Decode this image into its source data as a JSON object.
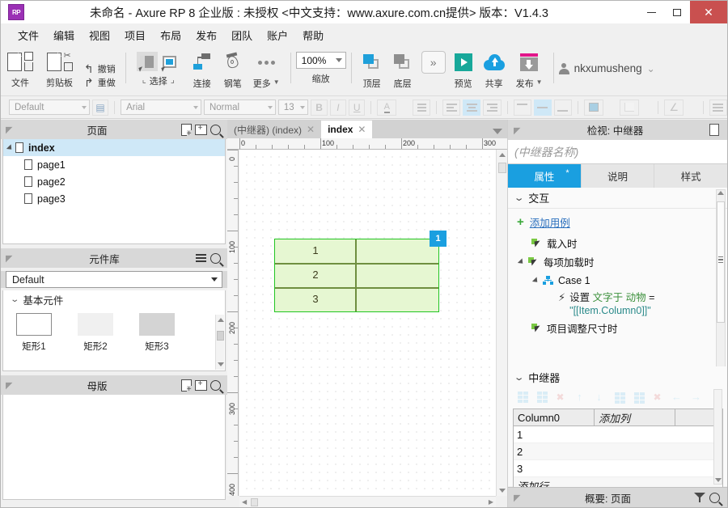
{
  "window": {
    "logo": "RP",
    "title": "未命名 - Axure RP 8 企业版 : 未授权    <中文支持：www.axure.com.cn提供> 版本：V1.4.3",
    "minimize": "−",
    "maximize": "□",
    "close": "✕"
  },
  "menubar": {
    "items": [
      "文件",
      "编辑",
      "视图",
      "项目",
      "布局",
      "发布",
      "团队",
      "账户",
      "帮助"
    ]
  },
  "ribbon": {
    "file_label": "文件",
    "clipboard_label": "剪贴板",
    "undo_label": "撤销",
    "redo_label": "重做",
    "select_label": "选择",
    "connect_label": "连接",
    "pen_label": "钢笔",
    "more_label": "更多",
    "zoom_value": "100%",
    "zoom_label": "缩放",
    "top_label": "顶层",
    "bottom_label": "底层",
    "overflow": "»",
    "preview_label": "预览",
    "share_label": "共享",
    "publish_label": "发布",
    "user_name": "nkxumusheng",
    "user_caret": "⌄"
  },
  "formatbar": {
    "style": "Default",
    "font": "Arial",
    "weight": "Normal",
    "size": "13",
    "bold": "B",
    "italic": "I",
    "underline": "U",
    "fontcolor": "A",
    "list": "☰"
  },
  "pages_panel": {
    "title": "页面",
    "tree": [
      {
        "label": "index",
        "selected": true,
        "level": 0
      },
      {
        "label": "page1",
        "selected": false,
        "level": 1
      },
      {
        "label": "page2",
        "selected": false,
        "level": 1
      },
      {
        "label": "page3",
        "selected": false,
        "level": 1
      }
    ]
  },
  "widgets_panel": {
    "title": "元件库",
    "library": "Default",
    "group": "基本元件",
    "items": [
      {
        "label": "矩形1"
      },
      {
        "label": "矩形2"
      },
      {
        "label": "矩形3"
      }
    ]
  },
  "masters_panel": {
    "title": "母版"
  },
  "canvas": {
    "tabs": [
      {
        "label": "(中继器) (index)",
        "active": false,
        "close": "✕"
      },
      {
        "label": "index",
        "active": true,
        "close": "✕"
      }
    ],
    "ruler_h": [
      "0",
      "100",
      "200",
      "300"
    ],
    "ruler_v": [
      "0",
      "100",
      "200",
      "300",
      "400"
    ],
    "repeater_rows": [
      "1",
      "2",
      "3"
    ],
    "selection_badge": "1"
  },
  "inspector": {
    "title": "检视: 中继器",
    "name_placeholder": "(中继器名称)",
    "tabs": [
      {
        "label": "属性",
        "active": true,
        "marker": "*"
      },
      {
        "label": "说明",
        "active": false
      },
      {
        "label": "样式",
        "active": false
      }
    ],
    "interaction_section": "交互",
    "add_case": "添加用例",
    "events": [
      {
        "label": "载入时",
        "indent": 0,
        "expandable": false
      },
      {
        "label": "每项加载时",
        "indent": 0,
        "expandable": true
      },
      {
        "label": "Case 1",
        "indent": 1,
        "expandable": true,
        "type": "case"
      },
      {
        "label": "项目调整尺寸时",
        "indent": 0,
        "expandable": false
      }
    ],
    "action": {
      "verb": "设置",
      "target": "文字于 动物",
      "equals": "=",
      "value": "\"[[Item.Column0]]\""
    },
    "repeater_section": "中继器",
    "repeater_table": {
      "columns": [
        "Column0",
        "添加列",
        ""
      ],
      "rows": [
        "1",
        "2",
        "3"
      ],
      "add_row": "添加行"
    }
  },
  "status": {
    "label": "概要: 页面"
  },
  "colors": {
    "accent_blue": "#1a9fe0",
    "selection_green": "#22c522",
    "cell_fill": "#e6f7d2",
    "cell_border": "#6f8f40",
    "close_red": "#c9504f",
    "logo_purple": "#9b30b5"
  }
}
